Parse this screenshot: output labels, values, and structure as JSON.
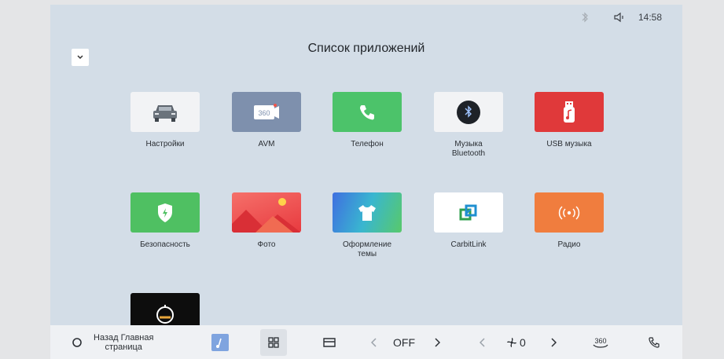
{
  "status": {
    "time": "14:58",
    "icons": [
      "bluetooth-icon",
      "volume-icon"
    ]
  },
  "header": {
    "title": "Список приложений"
  },
  "apps": [
    {
      "label": "Настройки",
      "icon": "car-icon",
      "bg": "#f2f3f5"
    },
    {
      "label": "AVM",
      "icon": "camera-360-icon",
      "bg": "#7e90ad"
    },
    {
      "label": "Телефон",
      "icon": "phone-icon",
      "bg": "#4cc36a"
    },
    {
      "label": "Музыка Bluetooth",
      "lines": [
        "Музыка",
        "Bluetooth"
      ],
      "icon": "bluetooth-icon",
      "bg": "#f2f3f5"
    },
    {
      "label": "USB музыка",
      "icon": "usb-music-icon",
      "bg": "#e0393a"
    },
    {
      "label": "Безопасность",
      "icon": "shield-icon",
      "bg": "#4fc062"
    },
    {
      "label": "Фото",
      "icon": "photo-icon",
      "bg": "#f0544a"
    },
    {
      "label": "Оформление темы",
      "lines": [
        "Оформление",
        "темы"
      ],
      "icon": "tshirt-icon",
      "bg": "#4a7ed8"
    },
    {
      "label": "CarbitLink",
      "icon": "carbitlink-icon",
      "bg": "#ffffff"
    },
    {
      "label": "Радио",
      "icon": "radio-icon",
      "bg": "#f07d3e"
    },
    {
      "label": "",
      "icon": "dashcam-icon",
      "bg": "#0d0d0d"
    }
  ],
  "bottombar": {
    "home_line1": "Назад Главная",
    "home_line2": "страница",
    "ac_value": "OFF",
    "fan_value": "0",
    "cam_label": "360"
  },
  "colors": {
    "screen_bg": "#d3dde7",
    "bar_bg": "#eff1f4",
    "accent": "#7fa4df"
  }
}
